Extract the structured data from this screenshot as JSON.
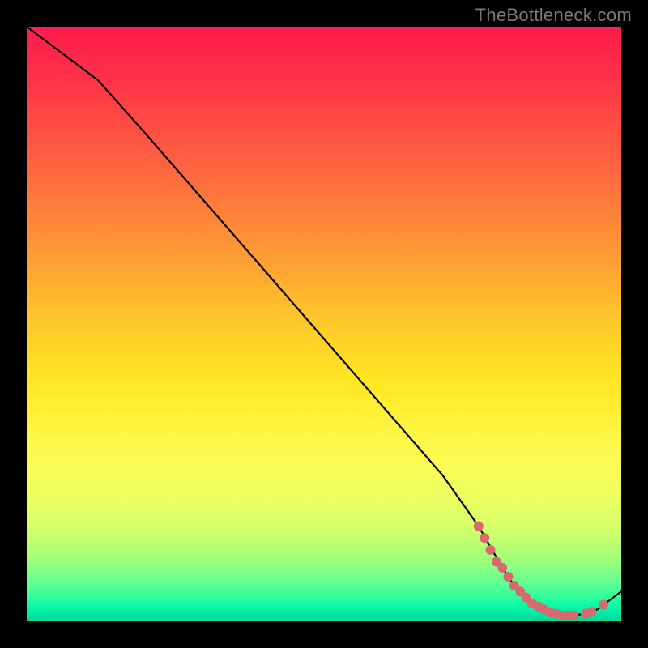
{
  "watermark": "TheBottleneck.com",
  "chart_data": {
    "type": "line",
    "title": "",
    "xlabel": "",
    "ylabel": "",
    "xlim": [
      0,
      100
    ],
    "ylim": [
      0,
      100
    ],
    "series": [
      {
        "name": "curve",
        "x": [
          0,
          4,
          8,
          12,
          20,
          30,
          40,
          50,
          60,
          70,
          76,
          80,
          82,
          84,
          86,
          88,
          90,
          92,
          94,
          96,
          100
        ],
        "y": [
          100,
          97,
          94,
          91,
          82,
          70.5,
          59,
          47.5,
          36,
          24.5,
          16,
          9,
          6,
          4,
          2.5,
          1.5,
          1,
          1,
          1.3,
          2,
          5
        ]
      },
      {
        "name": "markers",
        "x": [
          76,
          77,
          78,
          79,
          80,
          81,
          82,
          83,
          84,
          85,
          86,
          87,
          88,
          89,
          90,
          91,
          92,
          94,
          95,
          97
        ],
        "y": [
          16,
          14,
          12,
          10,
          9,
          7.5,
          6,
          5,
          4,
          3,
          2.5,
          2,
          1.5,
          1.3,
          1,
          1,
          1,
          1.3,
          1.6,
          2.8
        ]
      }
    ],
    "marker_color": "#d86a6f",
    "curve_color": "#000000"
  }
}
